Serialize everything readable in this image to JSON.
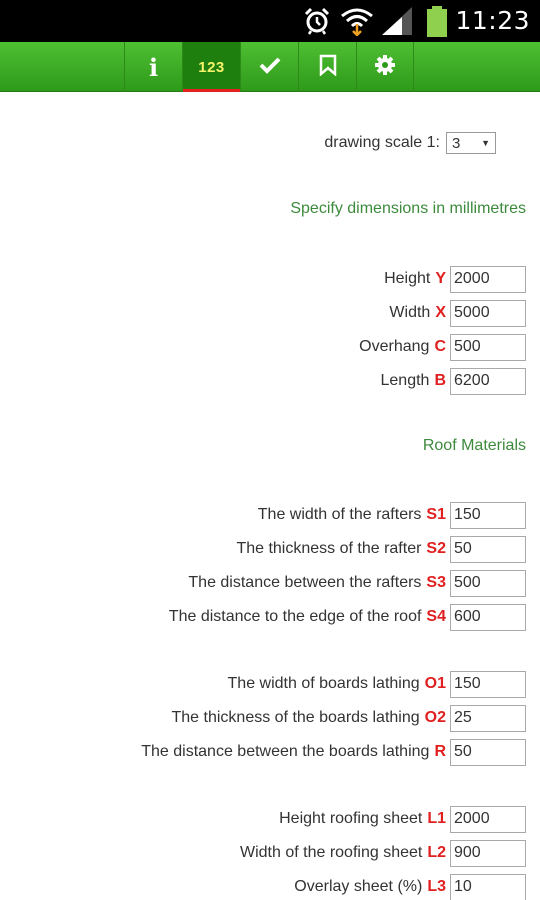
{
  "status_bar": {
    "time": "11:23"
  },
  "toolbar": {
    "tabs": [
      {
        "name": "info",
        "label": "i"
      },
      {
        "name": "numbers",
        "label": "123",
        "active": true
      },
      {
        "name": "check",
        "label": "check"
      },
      {
        "name": "bookmark",
        "label": "bookmark"
      },
      {
        "name": "settings",
        "label": "gear"
      }
    ]
  },
  "scale": {
    "label": "drawing scale 1:",
    "value": "3"
  },
  "sections": {
    "dimensions_title": "Specify dimensions in millimetres",
    "roof_materials_title": "Roof Materials"
  },
  "dimensions": [
    {
      "label": "Height",
      "code": "Y",
      "value": "2000"
    },
    {
      "label": "Width",
      "code": "X",
      "value": "5000"
    },
    {
      "label": "Overhang",
      "code": "C",
      "value": "500"
    },
    {
      "label": "Length",
      "code": "B",
      "value": "6200"
    }
  ],
  "rafters": [
    {
      "label": "The width of the rafters",
      "code": "S1",
      "value": "150"
    },
    {
      "label": "The thickness of the rafter",
      "code": "S2",
      "value": "50"
    },
    {
      "label": "The distance between the rafters",
      "code": "S3",
      "value": "500"
    },
    {
      "label": "The distance to the edge of the roof",
      "code": "S4",
      "value": "600"
    }
  ],
  "lathing": [
    {
      "label": "The width of boards lathing",
      "code": "O1",
      "value": "150"
    },
    {
      "label": "The thickness of the boards lathing",
      "code": "O2",
      "value": "25"
    },
    {
      "label": "The distance between the boards lathing",
      "code": "R",
      "value": "50"
    }
  ],
  "roofing_sheet": [
    {
      "label": "Height roofing sheet",
      "code": "L1",
      "value": "2000"
    },
    {
      "label": "Width of the roofing sheet",
      "code": "L2",
      "value": "900"
    },
    {
      "label": "Overlay sheet (%)",
      "code": "L3",
      "value": "10"
    }
  ],
  "colors": {
    "toolbar_green": "#2e9a1a",
    "accent_red": "#e02020",
    "section_green": "#3d8a3d",
    "tab_number_yellow": "#f5f36a"
  }
}
